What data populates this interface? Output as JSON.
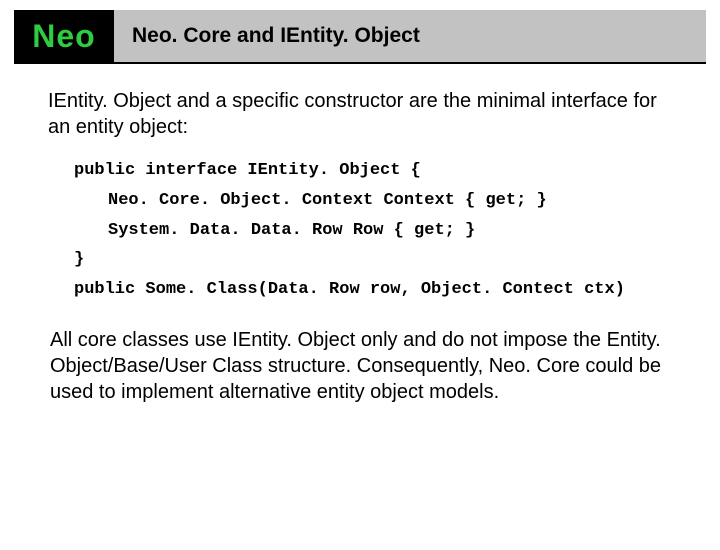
{
  "header": {
    "logo": "Neo",
    "title": "Neo. Core and IEntity. Object"
  },
  "intro": "IEntity. Object and a specific constructor are the minimal interface for an entity object:",
  "code": {
    "line1": "public interface IEntity. Object {",
    "line2": "Neo. Core. Object. Context Context { get; }",
    "line3": "System. Data. Data. Row Row { get; }",
    "line4": "}",
    "line5": "public Some. Class(Data. Row row, Object. Contect ctx)"
  },
  "footer": "All core classes use IEntity. Object only and do not impose the Entity. Object/Base/User Class structure. Consequently, Neo. Core could be used to implement alternative entity object models."
}
